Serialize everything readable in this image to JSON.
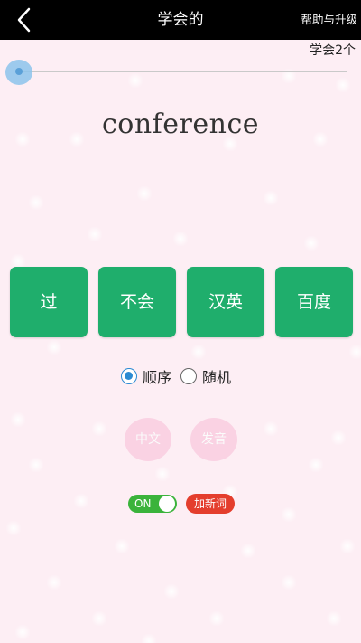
{
  "header": {
    "title": "学会的",
    "help_label": "帮助与升级"
  },
  "progress": {
    "learned_label": "学会2个",
    "slider_value": 0
  },
  "card": {
    "word": "conference"
  },
  "actions": {
    "pass": "过",
    "unknown": "不会",
    "zh_en": "汉英",
    "baidu": "百度"
  },
  "order": {
    "sequential": "顺序",
    "random": "随机",
    "selected": "sequential"
  },
  "extras": {
    "chinese": "中文",
    "pronounce": "发音"
  },
  "toggle": {
    "label": "ON",
    "state": "on"
  },
  "add_word_label": "加新词",
  "colors": {
    "header_bg": "#000000",
    "action_green": "#1fae6c",
    "background_pink": "#fdeef4",
    "radio_blue": "#2b8ad2",
    "toggle_green": "#3bb33b",
    "add_red": "#e43e2d",
    "soft_pink": "#fad2e3"
  }
}
